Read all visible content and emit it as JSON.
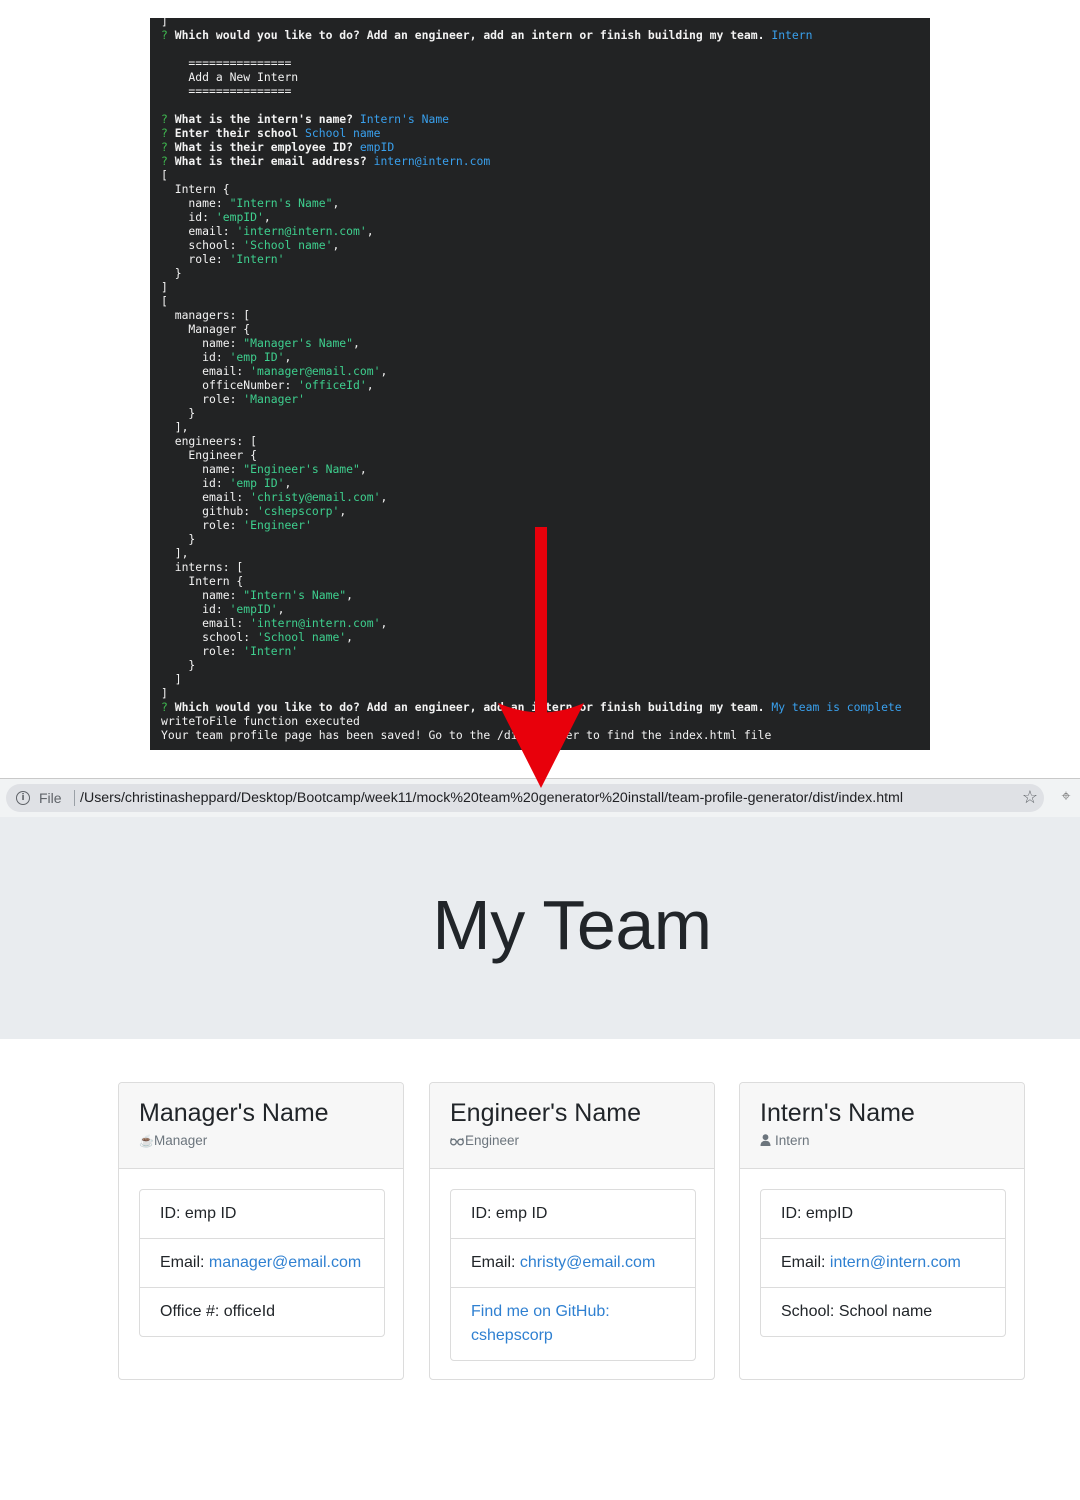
{
  "terminal": {
    "lines": [
      {
        "parts": [
          {
            "t": "]",
            "c": ""
          }
        ]
      },
      {
        "parts": [
          {
            "t": "? ",
            "c": "q"
          },
          {
            "t": "Which would you like to do? Add an engineer, add an intern or finish building my team. ",
            "c": "b"
          },
          {
            "t": "Intern",
            "c": "ans"
          }
        ]
      },
      {
        "parts": [
          {
            "t": "",
            "c": ""
          }
        ]
      },
      {
        "parts": [
          {
            "t": "    ===============",
            "c": ""
          }
        ]
      },
      {
        "parts": [
          {
            "t": "    Add a New Intern",
            "c": ""
          }
        ]
      },
      {
        "parts": [
          {
            "t": "    ===============",
            "c": ""
          }
        ]
      },
      {
        "parts": [
          {
            "t": "",
            "c": ""
          }
        ]
      },
      {
        "parts": [
          {
            "t": "? ",
            "c": "q"
          },
          {
            "t": "What is the intern's name? ",
            "c": "b"
          },
          {
            "t": "Intern's Name",
            "c": "ans"
          }
        ]
      },
      {
        "parts": [
          {
            "t": "? ",
            "c": "q"
          },
          {
            "t": "Enter their school ",
            "c": "b"
          },
          {
            "t": "School name",
            "c": "ans"
          }
        ]
      },
      {
        "parts": [
          {
            "t": "? ",
            "c": "q"
          },
          {
            "t": "What is their employee ID? ",
            "c": "b"
          },
          {
            "t": "empID",
            "c": "ans"
          }
        ]
      },
      {
        "parts": [
          {
            "t": "? ",
            "c": "q"
          },
          {
            "t": "What is their email address? ",
            "c": "b"
          },
          {
            "t": "intern@intern.com",
            "c": "ans"
          }
        ]
      },
      {
        "parts": [
          {
            "t": "[",
            "c": ""
          }
        ]
      },
      {
        "parts": [
          {
            "t": "  Intern {",
            "c": ""
          }
        ]
      },
      {
        "parts": [
          {
            "t": "    name: ",
            "c": ""
          },
          {
            "t": "\"Intern's Name\"",
            "c": "str"
          },
          {
            "t": ",",
            "c": ""
          }
        ]
      },
      {
        "parts": [
          {
            "t": "    id: ",
            "c": ""
          },
          {
            "t": "'empID'",
            "c": "str"
          },
          {
            "t": ",",
            "c": ""
          }
        ]
      },
      {
        "parts": [
          {
            "t": "    email: ",
            "c": ""
          },
          {
            "t": "'intern@intern.com'",
            "c": "str"
          },
          {
            "t": ",",
            "c": ""
          }
        ]
      },
      {
        "parts": [
          {
            "t": "    school: ",
            "c": ""
          },
          {
            "t": "'School name'",
            "c": "str"
          },
          {
            "t": ",",
            "c": ""
          }
        ]
      },
      {
        "parts": [
          {
            "t": "    role: ",
            "c": ""
          },
          {
            "t": "'Intern'",
            "c": "str"
          }
        ]
      },
      {
        "parts": [
          {
            "t": "  }",
            "c": ""
          }
        ]
      },
      {
        "parts": [
          {
            "t": "]",
            "c": ""
          }
        ]
      },
      {
        "parts": [
          {
            "t": "[",
            "c": ""
          }
        ]
      },
      {
        "parts": [
          {
            "t": "  managers: [",
            "c": ""
          }
        ]
      },
      {
        "parts": [
          {
            "t": "    Manager {",
            "c": ""
          }
        ]
      },
      {
        "parts": [
          {
            "t": "      name: ",
            "c": ""
          },
          {
            "t": "\"Manager's Name\"",
            "c": "str"
          },
          {
            "t": ",",
            "c": ""
          }
        ]
      },
      {
        "parts": [
          {
            "t": "      id: ",
            "c": ""
          },
          {
            "t": "'emp ID'",
            "c": "str"
          },
          {
            "t": ",",
            "c": ""
          }
        ]
      },
      {
        "parts": [
          {
            "t": "      email: ",
            "c": ""
          },
          {
            "t": "'manager@email.com'",
            "c": "str"
          },
          {
            "t": ",",
            "c": ""
          }
        ]
      },
      {
        "parts": [
          {
            "t": "      officeNumber: ",
            "c": ""
          },
          {
            "t": "'officeId'",
            "c": "str"
          },
          {
            "t": ",",
            "c": ""
          }
        ]
      },
      {
        "parts": [
          {
            "t": "      role: ",
            "c": ""
          },
          {
            "t": "'Manager'",
            "c": "str"
          }
        ]
      },
      {
        "parts": [
          {
            "t": "    }",
            "c": ""
          }
        ]
      },
      {
        "parts": [
          {
            "t": "  ],",
            "c": ""
          }
        ]
      },
      {
        "parts": [
          {
            "t": "  engineers: [",
            "c": ""
          }
        ]
      },
      {
        "parts": [
          {
            "t": "    Engineer {",
            "c": ""
          }
        ]
      },
      {
        "parts": [
          {
            "t": "      name: ",
            "c": ""
          },
          {
            "t": "\"Engineer's Name\"",
            "c": "str"
          },
          {
            "t": ",",
            "c": ""
          }
        ]
      },
      {
        "parts": [
          {
            "t": "      id: ",
            "c": ""
          },
          {
            "t": "'emp ID'",
            "c": "str"
          },
          {
            "t": ",",
            "c": ""
          }
        ]
      },
      {
        "parts": [
          {
            "t": "      email: ",
            "c": ""
          },
          {
            "t": "'christy@email.com'",
            "c": "str"
          },
          {
            "t": ",",
            "c": ""
          }
        ]
      },
      {
        "parts": [
          {
            "t": "      github: ",
            "c": ""
          },
          {
            "t": "'cshepscorp'",
            "c": "str"
          },
          {
            "t": ",",
            "c": ""
          }
        ]
      },
      {
        "parts": [
          {
            "t": "      role: ",
            "c": ""
          },
          {
            "t": "'Engineer'",
            "c": "str"
          }
        ]
      },
      {
        "parts": [
          {
            "t": "    }",
            "c": ""
          }
        ]
      },
      {
        "parts": [
          {
            "t": "  ],",
            "c": ""
          }
        ]
      },
      {
        "parts": [
          {
            "t": "  interns: [",
            "c": ""
          }
        ]
      },
      {
        "parts": [
          {
            "t": "    Intern {",
            "c": ""
          }
        ]
      },
      {
        "parts": [
          {
            "t": "      name: ",
            "c": ""
          },
          {
            "t": "\"Intern's Name\"",
            "c": "str"
          },
          {
            "t": ",",
            "c": ""
          }
        ]
      },
      {
        "parts": [
          {
            "t": "      id: ",
            "c": ""
          },
          {
            "t": "'empID'",
            "c": "str"
          },
          {
            "t": ",",
            "c": ""
          }
        ]
      },
      {
        "parts": [
          {
            "t": "      email: ",
            "c": ""
          },
          {
            "t": "'intern@intern.com'",
            "c": "str"
          },
          {
            "t": ",",
            "c": ""
          }
        ]
      },
      {
        "parts": [
          {
            "t": "      school: ",
            "c": ""
          },
          {
            "t": "'School name'",
            "c": "str"
          },
          {
            "t": ",",
            "c": ""
          }
        ]
      },
      {
        "parts": [
          {
            "t": "      role: ",
            "c": ""
          },
          {
            "t": "'Intern'",
            "c": "str"
          }
        ]
      },
      {
        "parts": [
          {
            "t": "    }",
            "c": ""
          }
        ]
      },
      {
        "parts": [
          {
            "t": "  ]",
            "c": ""
          }
        ]
      },
      {
        "parts": [
          {
            "t": "]",
            "c": ""
          }
        ]
      },
      {
        "parts": [
          {
            "t": "? ",
            "c": "q"
          },
          {
            "t": "Which would you like to do? Add an engineer, add an intern or finish building my team. ",
            "c": "b"
          },
          {
            "t": "My team is complete",
            "c": "ans"
          }
        ]
      },
      {
        "parts": [
          {
            "t": "writeToFile function executed",
            "c": ""
          }
        ]
      },
      {
        "parts": [
          {
            "t": "Your team profile page has been saved! Go to the /dist folder to find the index.html file",
            "c": ""
          }
        ]
      }
    ]
  },
  "browser": {
    "info_icon": "i",
    "scheme_label": "File",
    "url": "/Users/christinasheppard/Desktop/Bootcamp/week11/mock%20team%20generator%20install/team-profile-generator/dist/index.html",
    "bookmark_icon": "star-icon",
    "extension_icon": "extension-icon"
  },
  "page": {
    "title": "My Team"
  },
  "cards": [
    {
      "name": "Manager's Name",
      "role": "Manager",
      "role_icon": "coffee-icon",
      "role_glyph": "☕",
      "items": [
        {
          "label": "ID: ",
          "value": "emp ID",
          "link": false
        },
        {
          "label": "Email: ",
          "value": "manager@email.com",
          "link": true
        },
        {
          "label": "Office #: ",
          "value": "officeId",
          "link": false
        }
      ]
    },
    {
      "name": "Engineer's Name",
      "role": "Engineer",
      "role_icon": "glasses-icon",
      "role_glyph": "👓",
      "items": [
        {
          "label": "ID: ",
          "value": "emp ID",
          "link": false
        },
        {
          "label": "Email: ",
          "value": "christy@email.com",
          "link": true
        },
        {
          "label": "",
          "value": "Find me on GitHub: cshepscorp",
          "link": true
        }
      ]
    },
    {
      "name": "Intern's Name",
      "role": "Intern",
      "role_icon": "user-icon",
      "role_glyph": "👤",
      "items": [
        {
          "label": "ID: ",
          "value": "empID",
          "link": false
        },
        {
          "label": "Email: ",
          "value": "intern@intern.com",
          "link": true
        },
        {
          "label": "School: ",
          "value": "School name",
          "link": false
        }
      ]
    }
  ],
  "colors": {
    "terminal_bg": "#222324",
    "prompt_mark": "#3fb950",
    "answer": "#39a0ed",
    "string": "#3ecf8e",
    "link": "#2f80d1",
    "arrow": "#e8000b",
    "jumbotron_bg": "#e9ecef"
  }
}
